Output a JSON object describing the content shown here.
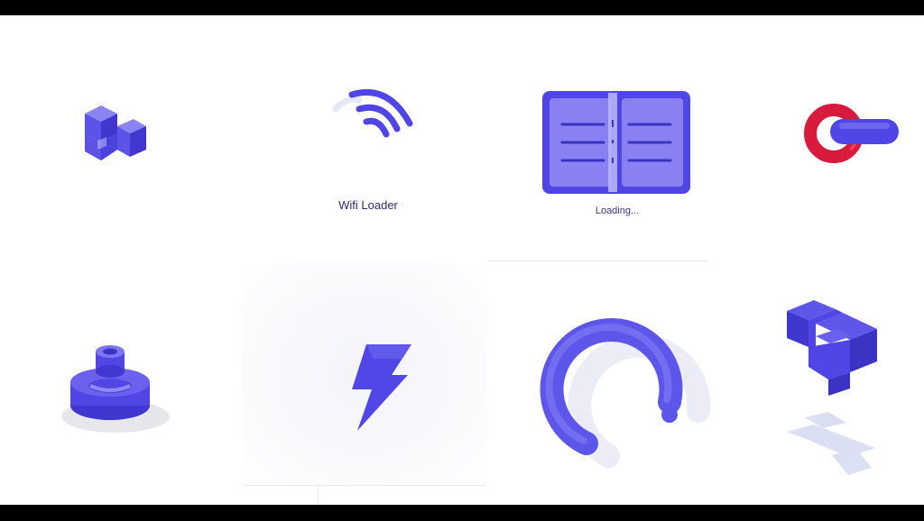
{
  "captions": {
    "wifi": "Wifi Loader",
    "book": "Loading..."
  },
  "icons": {
    "cube": "iso-blocks-icon",
    "wifi": "wifi-icon",
    "book": "open-book-icon",
    "link": "chain-link-icon",
    "stamp": "ring-stack-icon",
    "bolt": "lightning-bolt-icon",
    "ring": "liquid-ring-icon",
    "cross": "iso-cross-icon"
  },
  "colors": {
    "primary": "#4f46e5",
    "primary_light": "#6b63f0",
    "primary_dark": "#3a33c4",
    "accent_red": "#d81b3c",
    "caption_text": "#2d2a8c",
    "frame": "#000000"
  }
}
